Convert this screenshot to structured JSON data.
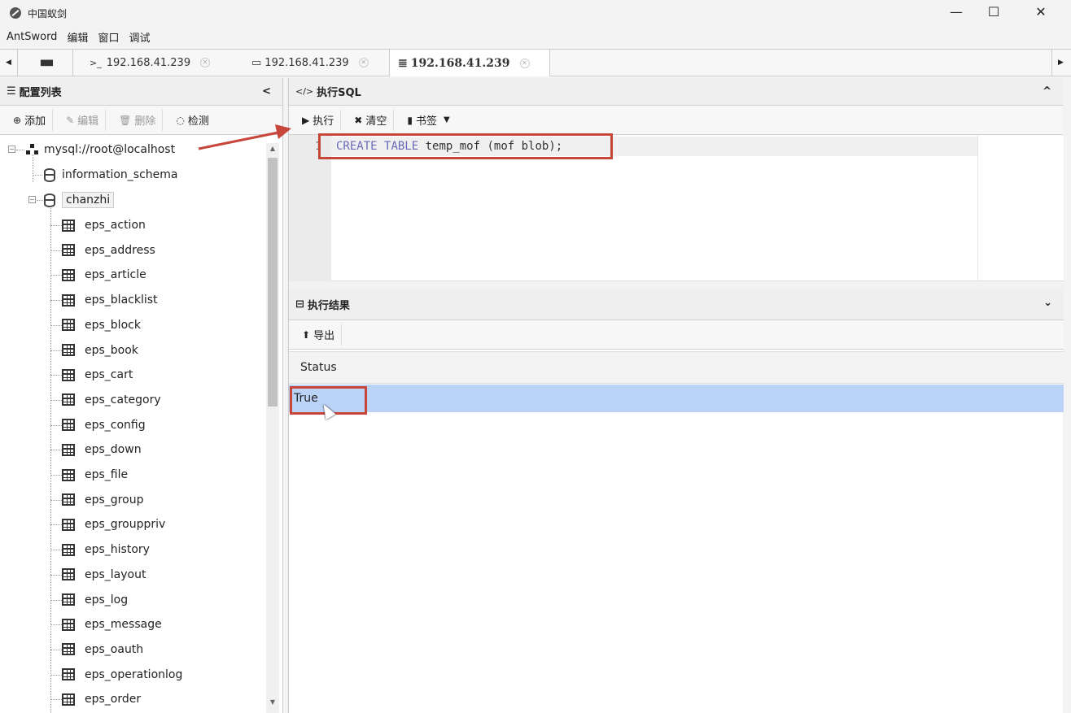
{
  "window": {
    "title": "中国蚁剑",
    "minimize": "—",
    "maximize": "☐",
    "close": "✕"
  },
  "menu": [
    "AntSword",
    "编辑",
    "窗口",
    "调试"
  ],
  "tabs": {
    "grid_icon": "■■",
    "items": [
      {
        "icon": ">_",
        "label": "192.168.41.239"
      },
      {
        "icon": "▭",
        "label": "192.168.41.239"
      },
      {
        "icon": "≣",
        "label": "192.168.41.239"
      }
    ],
    "left_arrow": "◀",
    "right_arrow": "▶"
  },
  "left": {
    "title": "配置列表",
    "collapse": "<",
    "toolbar": {
      "add": "添加",
      "edit": "编辑",
      "delete": "删除",
      "check": "检测"
    },
    "connection": "mysql://root@localhost",
    "databases": [
      "information_schema",
      "chanzhi"
    ],
    "tables": [
      "eps_action",
      "eps_address",
      "eps_article",
      "eps_blacklist",
      "eps_block",
      "eps_book",
      "eps_cart",
      "eps_category",
      "eps_config",
      "eps_down",
      "eps_file",
      "eps_group",
      "eps_grouppriv",
      "eps_history",
      "eps_layout",
      "eps_log",
      "eps_message",
      "eps_oauth",
      "eps_operationlog",
      "eps_order"
    ]
  },
  "sql": {
    "title": "执行SQL",
    "toolbar": {
      "run": "执行",
      "clear": "清空",
      "bookmark": "书签"
    },
    "line_number": "1",
    "code": {
      "kw1": "CREATE",
      "kw2": "TABLE",
      "rest": "temp_mof (mof blob);"
    }
  },
  "result": {
    "title": "执行结果",
    "export": "导出",
    "column": "Status",
    "value": "True"
  },
  "colors": {
    "annotation": "#c8453a",
    "selected_row": "#bcd3f8"
  }
}
